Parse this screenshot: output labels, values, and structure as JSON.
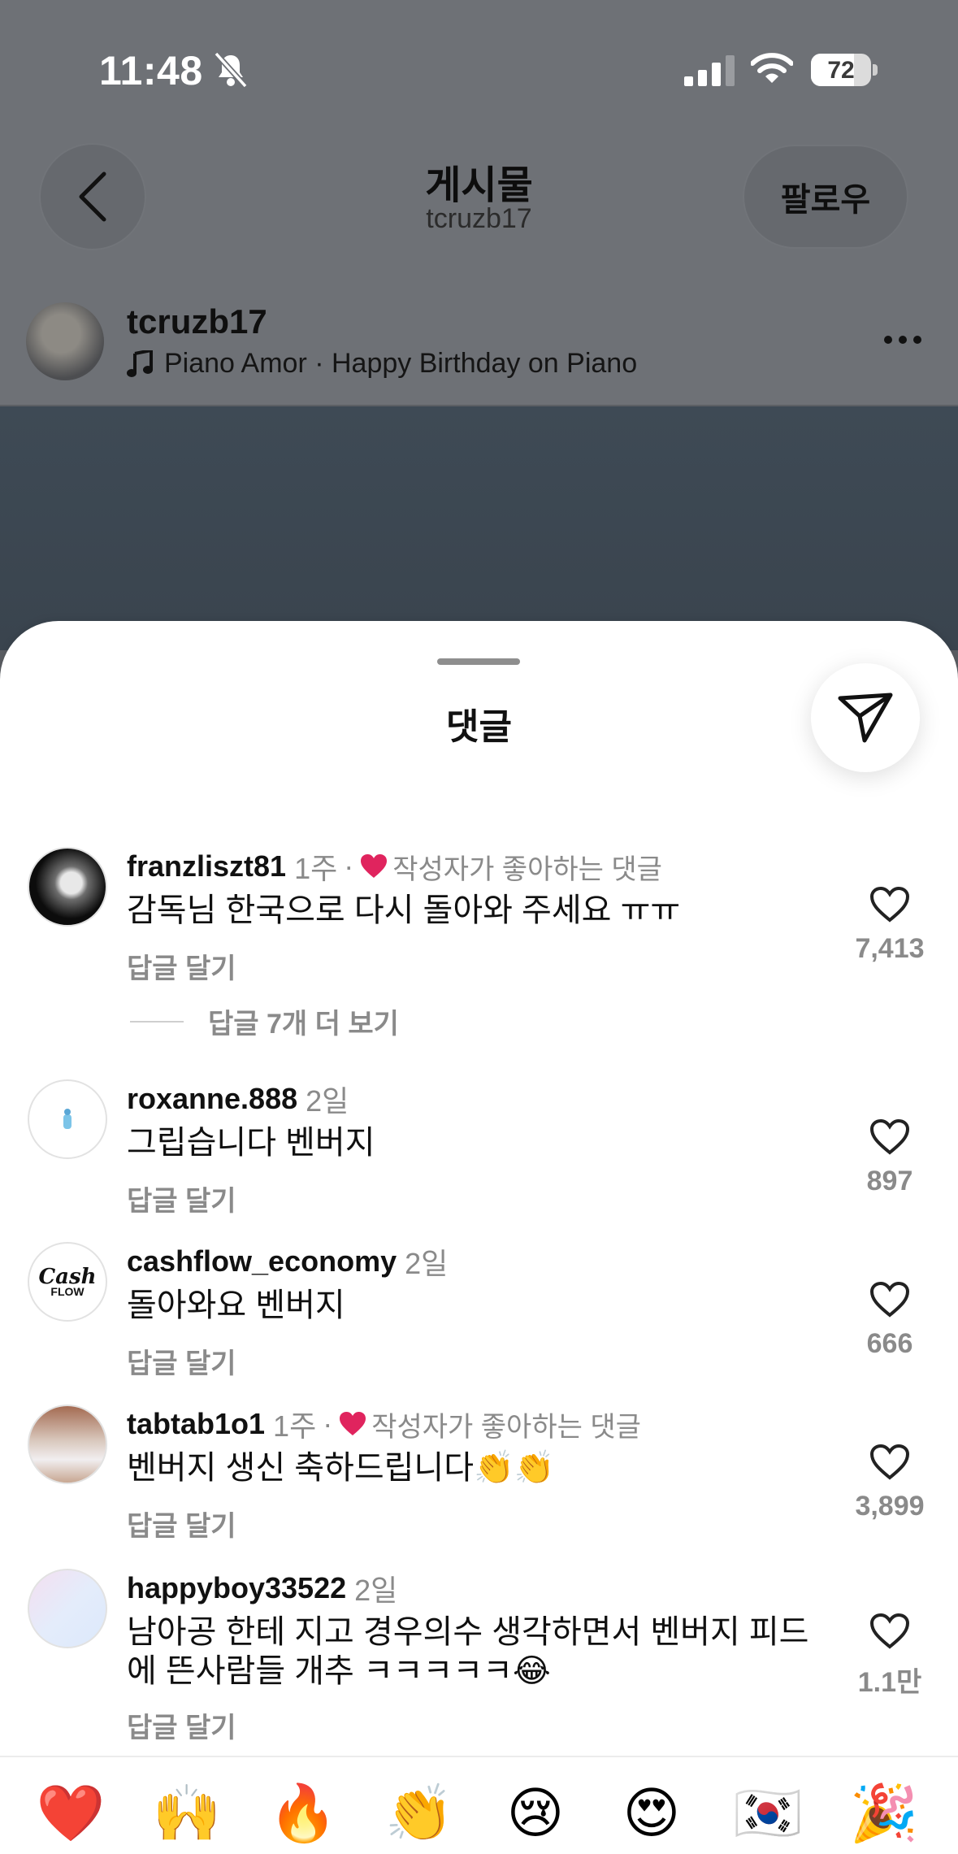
{
  "status_bar": {
    "time": "11:48",
    "battery": "72",
    "battery_level": 0.72
  },
  "nav": {
    "title": "게시물",
    "subtitle": "tcruzb17",
    "follow_label": "팔로우"
  },
  "post": {
    "username": "tcruzb17",
    "music": "Piano Amor · Happy Birthday on Piano"
  },
  "sheet": {
    "title": "댓글"
  },
  "comments": [
    {
      "username": "franzliszt81",
      "time": "1주",
      "creator_liked": "작성자가 좋아하는 댓글",
      "text": "감독님 한국으로 다시 돌아와 주세요 ㅠㅠ",
      "reply": "답글 달기",
      "likes": "7,413",
      "view_more": "답글 7개 더 보기"
    },
    {
      "username": "roxanne.888",
      "time": "2일",
      "text": "그립습니다 벤버지",
      "reply": "답글 달기",
      "likes": "897"
    },
    {
      "username": "cashflow_economy",
      "time": "2일",
      "text": "돌아와요 벤버지",
      "reply": "답글 달기",
      "likes": "666",
      "avatar_text": "Cash FLOW"
    },
    {
      "username": "tabtab1o1",
      "time": "1주",
      "creator_liked": "작성자가 좋아하는 댓글",
      "text": "벤버지 생신 축하드립니다👏👏",
      "reply": "답글 달기",
      "likes": "3,899"
    },
    {
      "username": "happyboy33522",
      "time": "2일",
      "text": "남아공 한테 지고 경우의수 생각하면서 벤버지 피드에 뜬사람들 개추 ㅋㅋㅋㅋㅋ😂",
      "reply": "답글 달기",
      "likes": "1.1만"
    }
  ],
  "emoji_bar": [
    "❤️",
    "🙌",
    "🔥",
    "👏",
    "😢",
    "😍",
    "🇰🇷",
    "🎉"
  ],
  "colors": {
    "sheet": "#ffffff",
    "muted_text": "#8a8a8a",
    "heart_red": "#e0245e",
    "dim_overlay": "#6e7176"
  }
}
